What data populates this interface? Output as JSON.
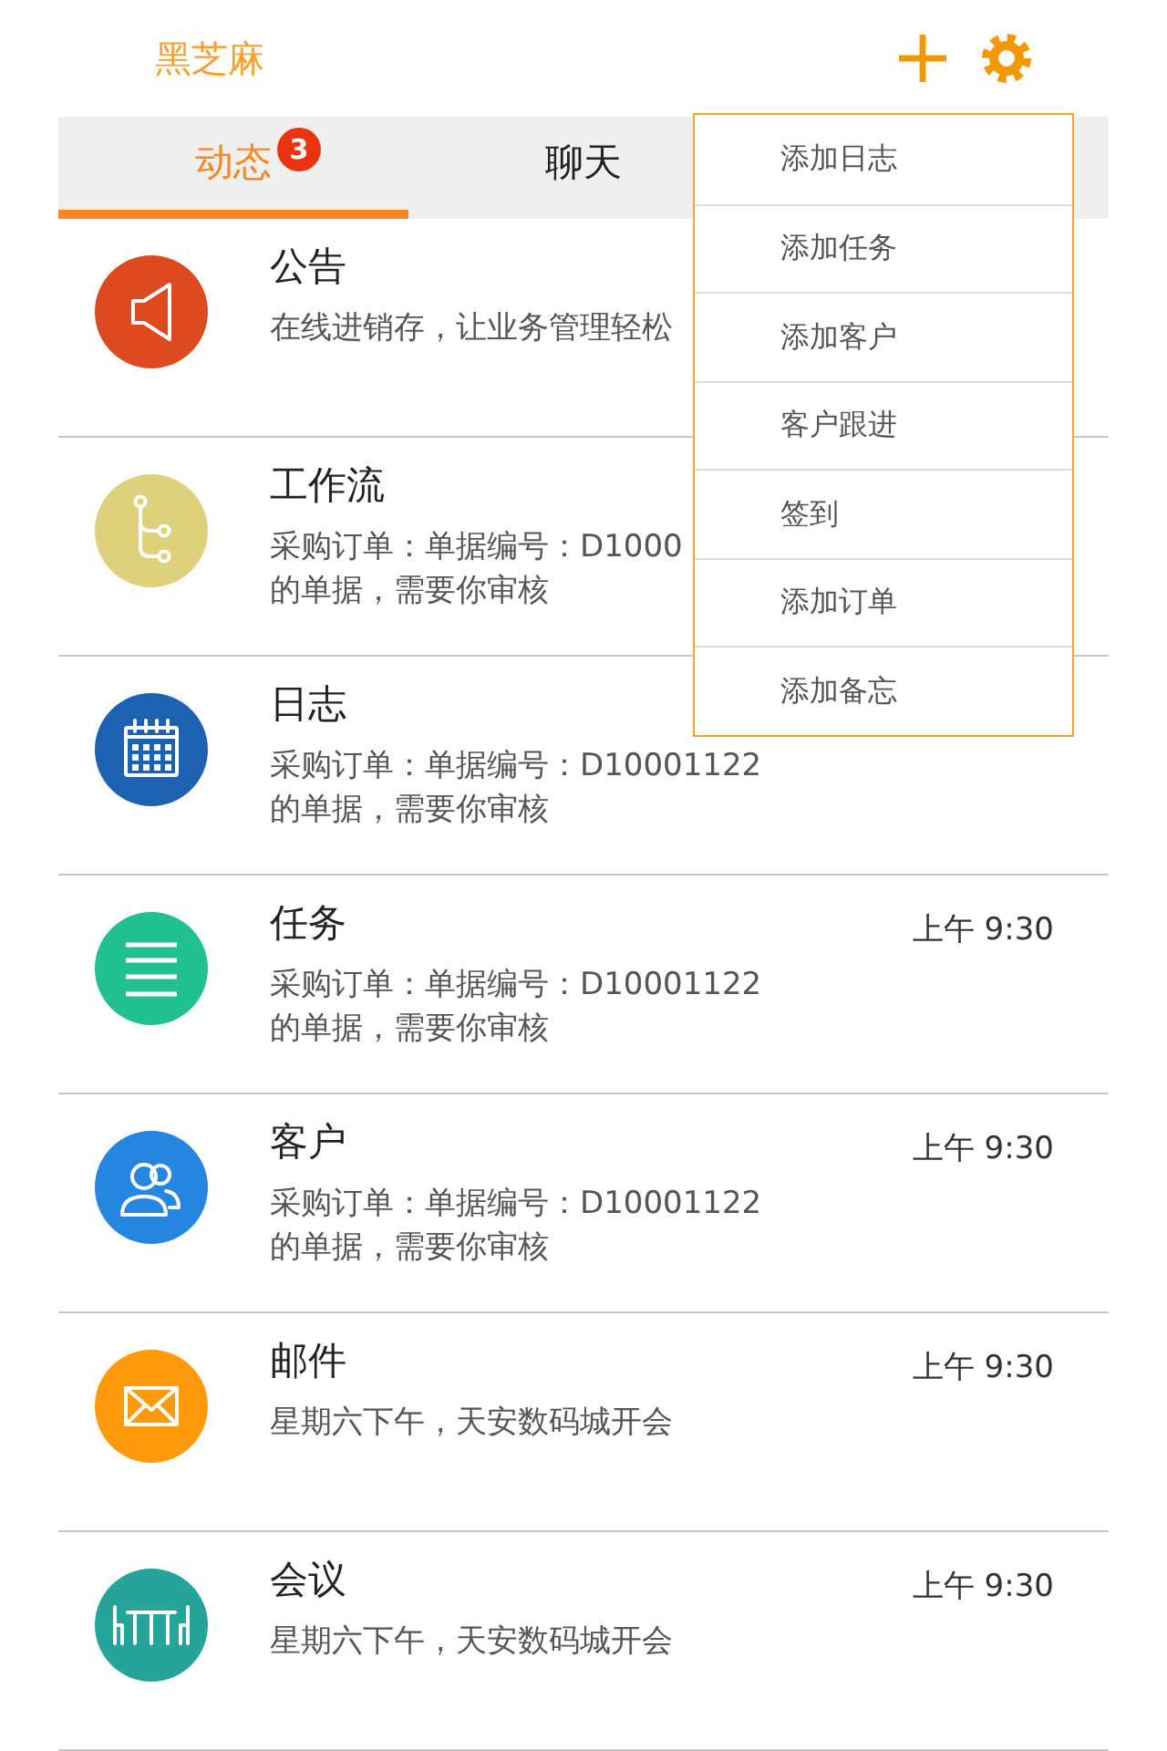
{
  "header": {
    "title": "黑芝麻"
  },
  "tabs": [
    {
      "label": "动态",
      "selected": true,
      "badge": "3"
    },
    {
      "label": "聊天",
      "selected": false
    }
  ],
  "items": [
    {
      "kind": "announcement",
      "color": "#dd4a1f",
      "title": "公告",
      "description": "在线进销存，让业务管理轻松"
    },
    {
      "kind": "workflow",
      "color": "#ddd27b",
      "title": "工作流",
      "description": "采购订单：单据编号：D1000\n的单据，需要你审核"
    },
    {
      "kind": "log",
      "color": "#1c62b0",
      "title": "日志",
      "description": "采购订单：单据编号：D10001122\n的单据，需要你审核"
    },
    {
      "kind": "task",
      "color": "#21c08f",
      "title": "任务",
      "description": "采购订单：单据编号：D10001122\n的单据，需要你审核",
      "time": "上午 9:30"
    },
    {
      "kind": "customer",
      "color": "#2585e0",
      "title": "客户",
      "description": "采购订单：单据编号：D10001122\n的单据，需要你审核",
      "time": "上午 9:30"
    },
    {
      "kind": "mail",
      "color": "#fe9a0c",
      "title": "邮件",
      "description": "星期六下午，天安数码城开会",
      "time": "上午 9:30"
    },
    {
      "kind": "meeting",
      "color": "#26a49a",
      "title": "会议",
      "description": "星期六下午，天安数码城开会",
      "time": "上午 9:30"
    }
  ],
  "menu": {
    "items": [
      "添加日志",
      "添加任务",
      "添加客户",
      "客户跟进",
      "签到",
      "添加订单",
      "添加备忘"
    ]
  }
}
